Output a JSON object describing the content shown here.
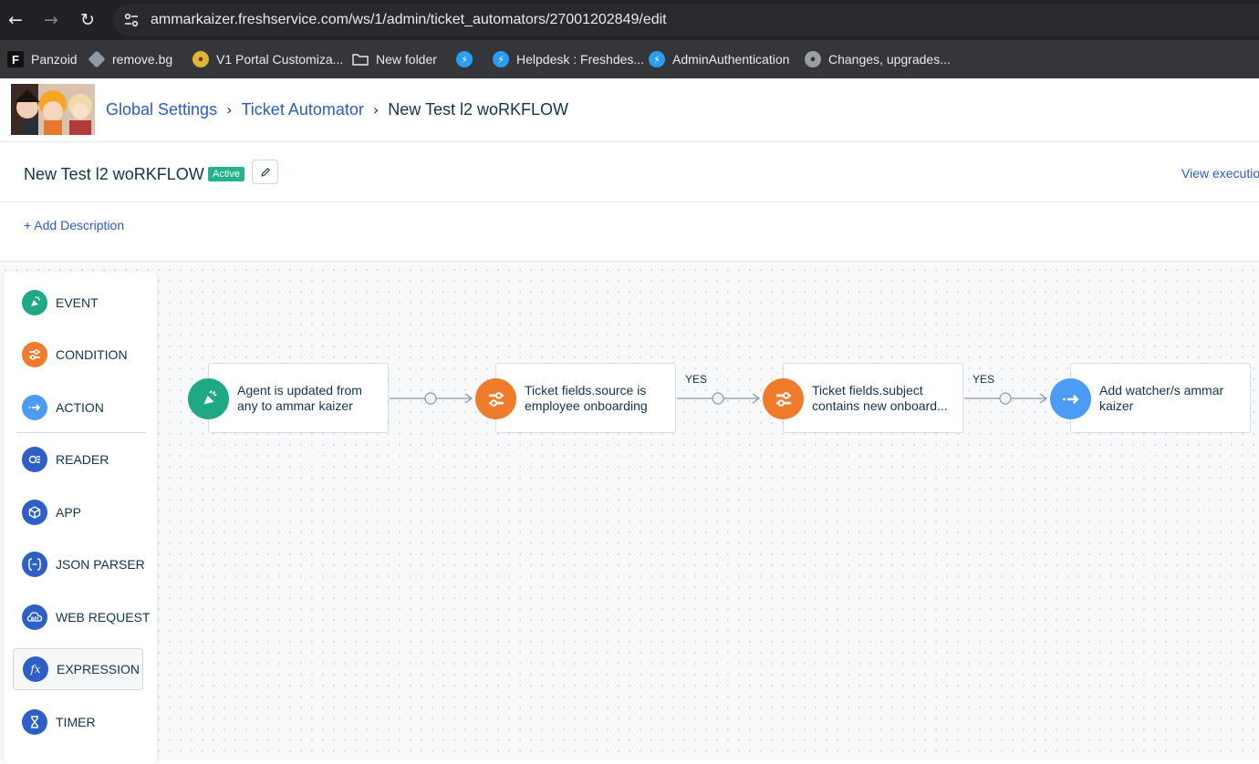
{
  "browser": {
    "url": "ammarkaizer.freshservice.com/ws/1/admin/ticket_automators/27001202849/edit",
    "bookmarks": [
      {
        "label": "Panzoid",
        "icon": "panzoid-icon"
      },
      {
        "label": "remove.bg",
        "icon": "removebg-icon"
      },
      {
        "label": "V1 Portal Customiza...",
        "icon": "portal-icon"
      },
      {
        "label": "New folder",
        "icon": "folder-icon"
      },
      {
        "label": "",
        "icon": "freshservice-icon"
      },
      {
        "label": "Helpdesk : Freshdes...",
        "icon": "freshservice-icon"
      },
      {
        "label": "AdminAuthentication",
        "icon": "freshservice-icon"
      },
      {
        "label": "Changes, upgrades...",
        "icon": "globe-icon"
      }
    ]
  },
  "header": {
    "breadcrumb": [
      "Global Settings",
      "Ticket Automator"
    ],
    "current": "New Test l2 woRKFLOW"
  },
  "workflow": {
    "title": "New Test l2 woRKFLOW",
    "status": "Active",
    "view_executions": "View execution",
    "add_description": "+ Add Description"
  },
  "palette": [
    {
      "label": "EVENT",
      "icon": "event-icon",
      "color": "#1fa884"
    },
    {
      "label": "CONDITION",
      "icon": "condition-icon",
      "color": "#ef7b2b"
    },
    {
      "label": "ACTION",
      "icon": "action-icon",
      "color": "#4b9cf5"
    },
    {
      "label": "READER",
      "icon": "reader-icon",
      "color": "#2d5fc6"
    },
    {
      "label": "APP",
      "icon": "app-icon",
      "color": "#2d5fc6"
    },
    {
      "label": "JSON PARSER",
      "icon": "json-parser-icon",
      "color": "#2d5fc6"
    },
    {
      "label": "WEB REQUEST",
      "icon": "web-request-icon",
      "color": "#2d5fc6"
    },
    {
      "label": "EXPRESSION",
      "icon": "expression-icon",
      "color": "#2d5fc6",
      "selected": true
    },
    {
      "label": "TIMER",
      "icon": "timer-icon",
      "color": "#2d5fc6"
    }
  ],
  "flow": {
    "nodes": [
      {
        "type": "event",
        "text": "Agent is updated from any to ammar kaizer",
        "color": "#1fa884"
      },
      {
        "type": "condition",
        "text": "Ticket fields.source is employee onboarding",
        "color": "#ef7b2b"
      },
      {
        "type": "condition",
        "text": "Ticket fields.subject contains new onboard...",
        "color": "#ef7b2b"
      },
      {
        "type": "action",
        "text": "Add watcher/s ammar kaizer",
        "color": "#4b9cf5"
      }
    ],
    "connector_labels": [
      "",
      "YES",
      "YES"
    ]
  }
}
